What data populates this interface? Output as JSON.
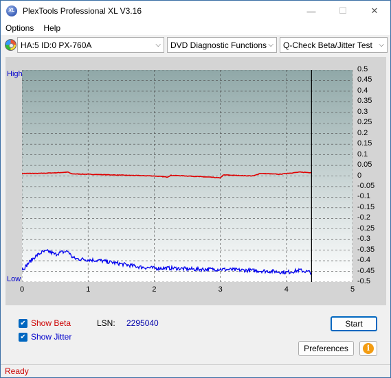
{
  "window": {
    "title": "PlexTools Professional XL V3.16",
    "app_icon_text": "XL",
    "minimize": "—",
    "maximize": "☐",
    "close": "✕"
  },
  "menu": {
    "options": "Options",
    "help": "Help"
  },
  "toolbar": {
    "drive": "HA:5 ID:0  PX-760A",
    "function": "DVD Diagnostic Functions",
    "test": "Q-Check Beta/Jitter Test"
  },
  "chart": {
    "left_high": "High",
    "left_low": "Low",
    "right_ticks": [
      "0.5",
      "0.45",
      "0.4",
      "0.35",
      "0.3",
      "0.25",
      "0.2",
      "0.15",
      "0.1",
      "0.05",
      "0",
      "-0.05",
      "-0.1",
      "-0.15",
      "-0.2",
      "-0.25",
      "-0.3",
      "-0.35",
      "-0.4",
      "-0.45",
      "-0.5"
    ],
    "x_ticks": [
      "0",
      "1",
      "2",
      "3",
      "4",
      "5"
    ]
  },
  "chart_data": {
    "type": "line",
    "x_range": [
      0,
      5
    ],
    "y_range": [
      -0.5,
      0.5
    ],
    "x_ticks": [
      0,
      1,
      2,
      3,
      4,
      5
    ],
    "y_ticks": [
      0.5,
      0.45,
      0.4,
      0.35,
      0.3,
      0.25,
      0.2,
      0.15,
      0.1,
      0.05,
      0,
      -0.05,
      -0.1,
      -0.15,
      -0.2,
      -0.25,
      -0.3,
      -0.35,
      -0.4,
      -0.45,
      -0.5
    ],
    "grid": true,
    "end_marker_x": 4.38,
    "series": [
      {
        "color": "#e00000",
        "x": [
          0,
          0.25,
          0.5,
          0.7,
          0.75,
          1.0,
          1.5,
          2.0,
          2.2,
          2.25,
          2.5,
          2.8,
          3.0,
          3.05,
          3.4,
          3.5,
          3.6,
          3.9,
          4.0,
          4.2,
          4.38
        ],
        "y": [
          0.012,
          0.012,
          0.015,
          0.018,
          0.01,
          0.008,
          0.004,
          0.0,
          -0.005,
          0.003,
          0.0,
          -0.005,
          -0.009,
          0.005,
          0.001,
          0.0,
          0.012,
          0.008,
          0.012,
          0.018,
          0.016
        ]
      },
      {
        "color": "#0000ee",
        "x": [
          0,
          0.05,
          0.1,
          0.2,
          0.3,
          0.4,
          0.5,
          0.6,
          0.7,
          0.75,
          0.8,
          1.0,
          1.2,
          1.4,
          1.6,
          1.8,
          2.0,
          2.3,
          2.6,
          3.0,
          3.4,
          3.8,
          4.0,
          4.2,
          4.38
        ],
        "y": [
          -0.44,
          -0.43,
          -0.41,
          -0.38,
          -0.36,
          -0.355,
          -0.37,
          -0.36,
          -0.355,
          -0.38,
          -0.39,
          -0.395,
          -0.4,
          -0.41,
          -0.42,
          -0.43,
          -0.435,
          -0.435,
          -0.44,
          -0.44,
          -0.445,
          -0.45,
          -0.455,
          -0.445,
          -0.455
        ]
      }
    ]
  },
  "bottom": {
    "show_beta": "Show Beta",
    "show_beta_check": "✔",
    "show_jitter": "Show Jitter",
    "show_jitter_check": "✔",
    "lsn_label": "LSN:",
    "lsn_value": "2295040",
    "start": "Start",
    "preferences": "Preferences",
    "info_glyph": "i"
  },
  "status": {
    "text": "Ready"
  },
  "colors": {
    "beta_label": "#cc0000",
    "jitter_label": "#0000cc",
    "beta_series": "#e00000",
    "jitter_series": "#0000ee",
    "status_text": "#cc0000"
  }
}
